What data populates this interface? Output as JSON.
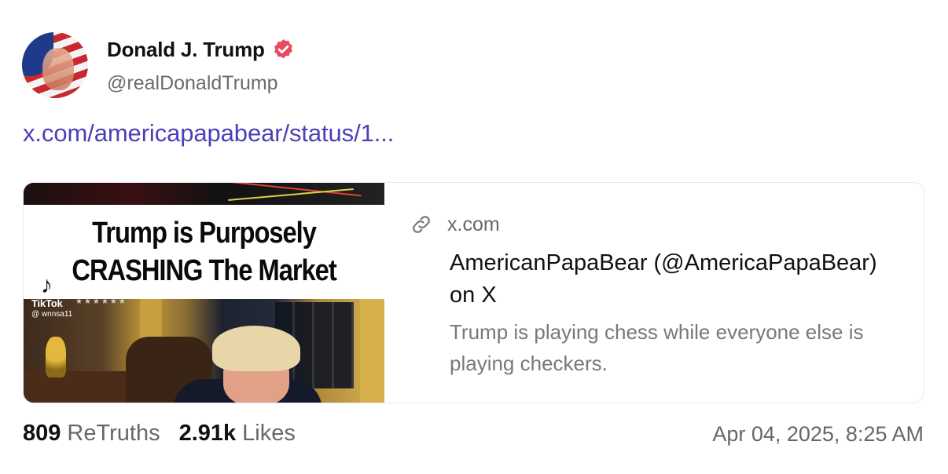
{
  "author": {
    "display_name": "Donald J. Trump",
    "handle": "@realDonaldTrump",
    "verified_icon": "verified-badge-icon",
    "badge_color": "#e84a5f"
  },
  "post": {
    "link_text": "x.com/americapapabear/status/1...",
    "link_color": "#4c3fb8"
  },
  "link_card": {
    "domain": "x.com",
    "title": "AmericanPapaBear (@AmericaPapaBear) on X",
    "description": "Trump is playing chess while everyone else is playing checkers.",
    "thumbnail": {
      "headline_line1": "Trump is Purposely",
      "headline_line2": "CRASHING The Market",
      "watermark_name": "TikTok",
      "watermark_user": "@ wnnsa11"
    }
  },
  "stats": {
    "retruths_count": "809",
    "retruths_label": "ReTruths",
    "likes_count": "2.91k",
    "likes_label": "Likes"
  },
  "timestamp": "Apr 04, 2025, 8:25 AM"
}
